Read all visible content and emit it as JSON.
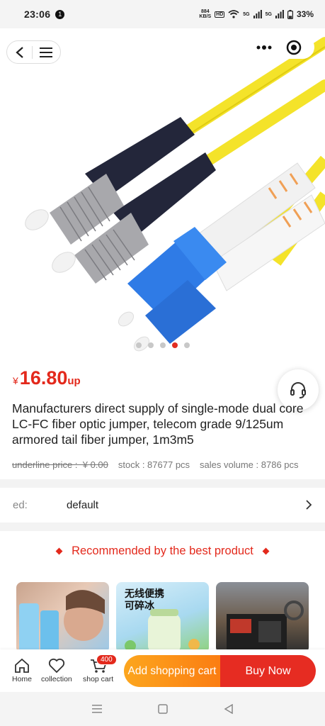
{
  "status_bar": {
    "time": "23:06",
    "notification_count": "1",
    "net_speed_top": "884",
    "net_speed_bottom": "KB/S",
    "hd_label": "HD",
    "signal_1": "5G",
    "signal_2": "5G",
    "battery": "33%"
  },
  "gallery": {
    "image_count": 5,
    "active_index": 3
  },
  "product": {
    "price_symbol": "¥",
    "price": "16.80",
    "price_suffix": "up",
    "title": "Manufacturers direct supply of single-mode dual core LC-FC fiber optic jumper, telecom grade 9/125um armored tail fiber jumper, 1m3m5",
    "underline_price": "underline price :  ¥ 0.00",
    "stock": "stock : 87677 pcs",
    "sales_volume": "sales volume : 8786 pcs"
  },
  "spec": {
    "key": "ed:",
    "value": "default"
  },
  "recommend": {
    "title": "Recommended by the best product",
    "items": [
      {
        "label": ""
      },
      {
        "label": "无线便携\n可碎冰"
      },
      {
        "label": ""
      }
    ]
  },
  "bottom_bar": {
    "home": "Home",
    "collection": "collection",
    "shop_cart": "shop cart",
    "cart_count": "400",
    "add_cart": "Add shopping cart",
    "buy_now": "Buy Now"
  },
  "colors": {
    "accent_red": "#e3291c",
    "orange": "#fb7d12",
    "cable_yellow": "#f4e32a",
    "connector_blue": "#2f7be6"
  }
}
